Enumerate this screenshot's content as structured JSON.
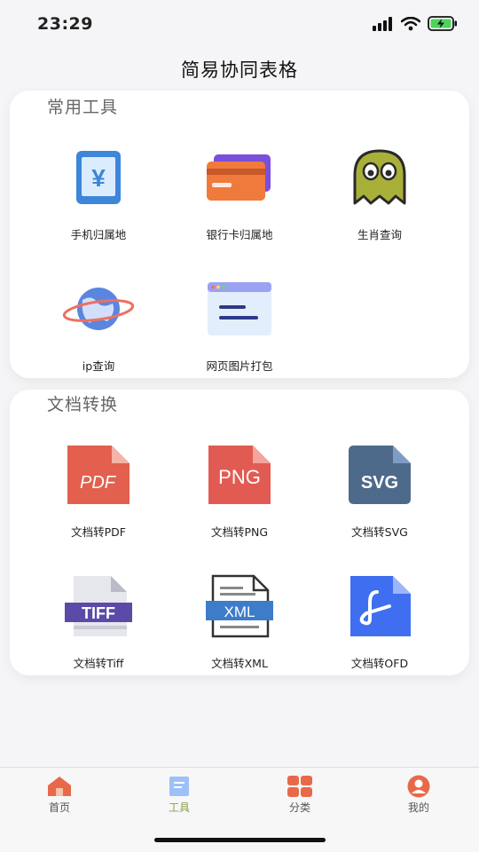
{
  "status_bar": {
    "time": "23:29"
  },
  "header": {
    "title": "简易协同表格"
  },
  "sections": [
    {
      "title": "常用工具",
      "tools": [
        {
          "label": "手机归属地",
          "icon": "phone-yen-icon"
        },
        {
          "label": "银行卡归属地",
          "icon": "bank-card-icon"
        },
        {
          "label": "生肖查询",
          "icon": "ghost-icon"
        },
        {
          "label": "ip查询",
          "icon": "planet-icon"
        },
        {
          "label": "网页图片打包",
          "icon": "browser-window-icon"
        }
      ]
    },
    {
      "title": "文档转换",
      "tools": [
        {
          "label": "文档转PDF",
          "icon": "pdf-file-icon",
          "badge": "PDF"
        },
        {
          "label": "文档转PNG",
          "icon": "png-file-icon",
          "badge": "PNG"
        },
        {
          "label": "文档转SVG",
          "icon": "svg-file-icon",
          "badge": "SVG"
        },
        {
          "label": "文档转Tiff",
          "icon": "tiff-file-icon",
          "badge": "TIFF"
        },
        {
          "label": "文档转XML",
          "icon": "xml-file-icon",
          "badge": "XML"
        },
        {
          "label": "文档转OFD",
          "icon": "ofd-file-icon"
        }
      ]
    }
  ],
  "tabbar": {
    "items": [
      {
        "label": "首页",
        "icon": "home-icon",
        "active": false
      },
      {
        "label": "工具",
        "icon": "notebook-icon",
        "active": true
      },
      {
        "label": "分类",
        "icon": "grid-icon",
        "active": false
      },
      {
        "label": "我的",
        "icon": "user-icon",
        "active": false
      }
    ]
  },
  "colors": {
    "accent": "#e8694a",
    "active_tab": "#8aa14a",
    "pdf": "#e2604d",
    "png": "#e25b52",
    "svg": "#4e6a8a",
    "tiff": "#5c4aa8",
    "xml": "#3d7cc9",
    "ofd": "#3f6ff0"
  }
}
